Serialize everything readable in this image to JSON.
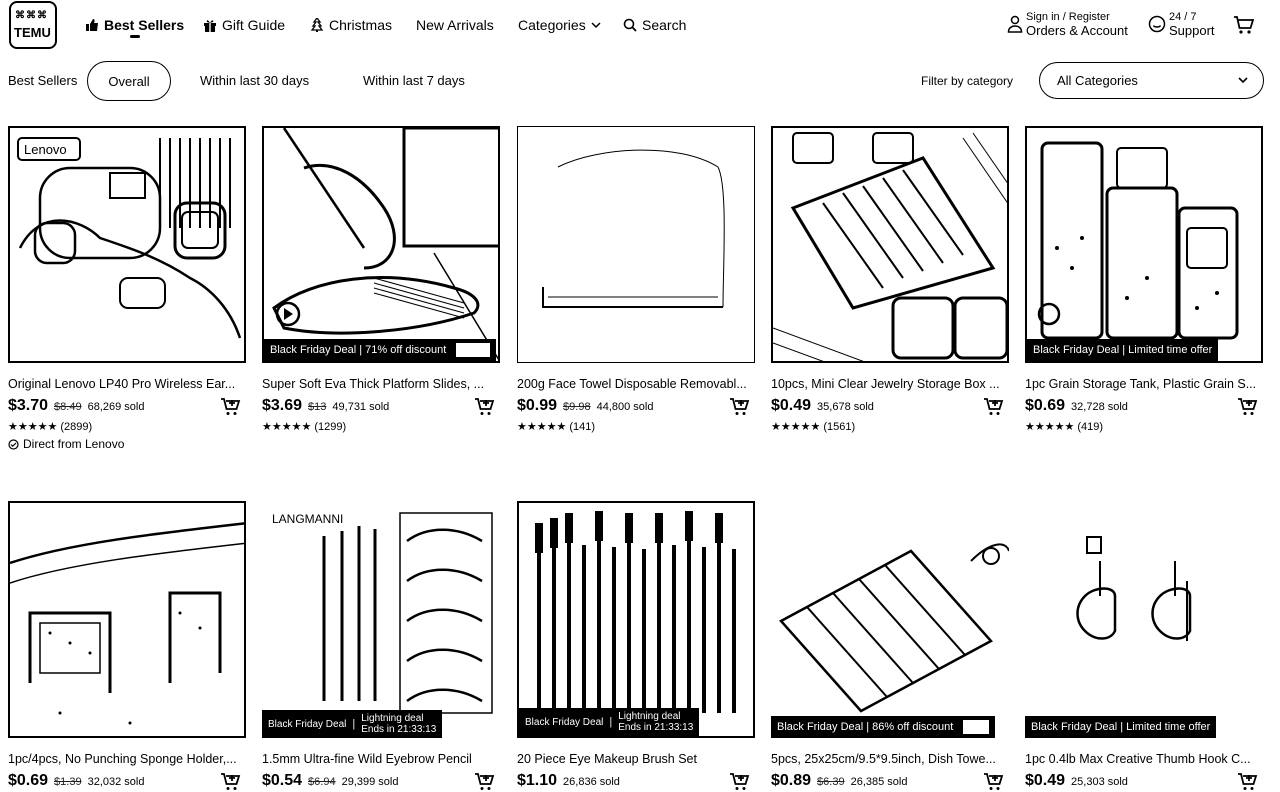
{
  "brand": {
    "line1": "⌘⌘⌘",
    "line2": "TEMU"
  },
  "nav": {
    "items": [
      {
        "label": "Best Sellers",
        "icon": "thumbs-up-icon"
      },
      {
        "label": "Gift Guide",
        "icon": "gift-icon"
      },
      {
        "label": "Christmas",
        "icon": "christmas-tree-icon"
      },
      {
        "label": "New Arrivals",
        "icon": ""
      },
      {
        "label": "Categories",
        "icon": "chevron-down-icon"
      },
      {
        "label": "Search",
        "icon": "search-icon"
      }
    ],
    "account": {
      "line1": "Sign in / Register",
      "line2": "Orders & Account"
    },
    "support": {
      "line1": "24 / 7",
      "line2": "Support"
    }
  },
  "filters": {
    "section_label": "Best Sellers",
    "tabs": [
      "Overall",
      "Within last 30 days",
      "Within last 7 days"
    ],
    "filter_label": "Filter by category",
    "category_select": "All Categories"
  },
  "products": [
    {
      "title": "Original Lenovo LP40 Pro Wireless Ear...",
      "price": "$3.70",
      "orig": "$8.49",
      "sold": "68,269 sold",
      "stars": "★★★★★",
      "reviews": "(2899)",
      "badge": "",
      "note": "Direct from Lenovo"
    },
    {
      "title": "Super Soft Eva Thick Platform Slides, ...",
      "price": "$3.69",
      "orig": "$13",
      "sold": "49,731 sold",
      "stars": "★★★★★",
      "reviews": "(1299)",
      "badge": "Black Friday Deal | 71% off discount"
    },
    {
      "title": "200g Face Towel Disposable Removabl...",
      "price": "$0.99",
      "orig": "$9.98",
      "sold": "44,800 sold",
      "stars": "★★★★★",
      "reviews": "(141)",
      "badge": ""
    },
    {
      "title": "10pcs, Mini Clear Jewelry Storage Box ...",
      "price": "$0.49",
      "orig": "",
      "sold": "35,678 sold",
      "stars": "★★★★★",
      "reviews": "(1561)",
      "badge": ""
    },
    {
      "title": "1pc Grain Storage Tank, Plastic Grain S...",
      "price": "$0.69",
      "orig": "",
      "sold": "32,728 sold",
      "stars": "★★★★★",
      "reviews": "(419)",
      "badge": "Black Friday Deal | Limited time offer"
    },
    {
      "title": "1pc/4pcs, No Punching Sponge Holder,...",
      "price": "$0.69",
      "orig": "$1.39",
      "sold": "32,032 sold",
      "badge": ""
    },
    {
      "title": "1.5mm Ultra-fine Wild Eyebrow Pencil",
      "price": "$0.54",
      "orig": "$6.94",
      "sold": "29,399 sold",
      "badge_a": "Black Friday Deal",
      "badge_b1": "Lightning deal",
      "badge_b2": "Ends in  21:33:13",
      "brand_text": "LANGMANNI"
    },
    {
      "title": "20 Piece Eye Makeup Brush Set",
      "price": "$1.10",
      "orig": "",
      "sold": "26,836 sold",
      "badge_a": "Black Friday Deal",
      "badge_b1": "Lightning deal",
      "badge_b2": "Ends in  21:33:13"
    },
    {
      "title": "5pcs, 25x25cm/9.5*9.5inch, Dish Towe...",
      "price": "$0.89",
      "orig": "$6.39",
      "sold": "26,385 sold",
      "badge": "Black Friday Deal | 86% off discount"
    },
    {
      "title": "1pc 0.4lb Max Creative Thumb Hook C...",
      "price": "$0.49",
      "orig": "",
      "sold": "25,303 sold",
      "badge": "Black Friday Deal | Limited time offer"
    }
  ]
}
